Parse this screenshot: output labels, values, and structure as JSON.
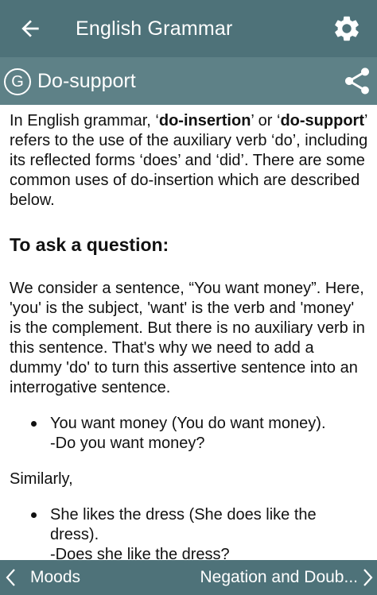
{
  "app_bar": {
    "title": "English Grammar",
    "back_icon": "arrow-left-icon",
    "settings_icon": "gear-icon"
  },
  "topic_bar": {
    "badge_letter": "G",
    "topic": "Do-support",
    "share_icon": "share-icon"
  },
  "content": {
    "intro": {
      "before_1": "In English grammar, ‘",
      "bold_1": "do-insertion",
      "middle": "’ or ‘",
      "bold_2": "do-support",
      "after": "’ refers to the use of the auxiliary verb ‘do’, including its reflected forms ‘does’ and ‘did’. There are some common uses of do-insertion which are described below."
    },
    "heading": "To ask a question:",
    "paragraph": "We consider a sentence, “You want money”. Here, 'you' is the subject, 'want' is the verb and 'money' is the complement. But there is no auxiliary verb in this sentence. That's why we need to add a dummy 'do' to turn this assertive sentence into an interrogative sentence.",
    "bullet_1": {
      "line_1": "You want money (You do want money).",
      "line_2": "-Do you want money?"
    },
    "similarly": "Similarly,",
    "bullet_2": {
      "line_1": "She likes the dress (She does like the dress).",
      "line_2": "-Does she like the dress?"
    }
  },
  "bottom_nav": {
    "prev_label": "Moods",
    "next_label": "Negation and Doub...",
    "prev_icon": "chevron-left-icon",
    "next_icon": "chevron-right-icon"
  },
  "colors": {
    "app_bar": "#4e7279",
    "topic_bar": "#5e8187",
    "bottom_bar": "#4e7279",
    "text": "#111111"
  }
}
